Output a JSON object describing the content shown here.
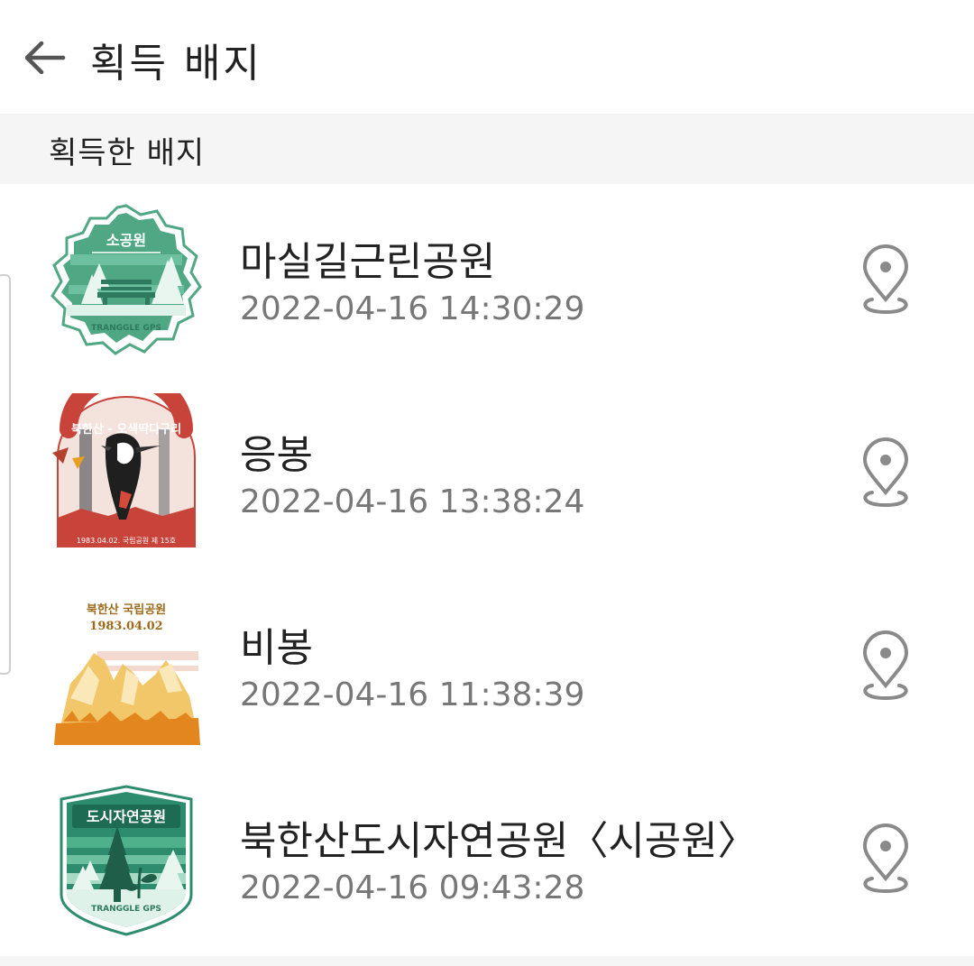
{
  "header": {
    "title": "획득 배지"
  },
  "section": {
    "title": "획득한 배지"
  },
  "badges": [
    {
      "name": "마실길근린공원",
      "time": "2022-04-16 14:30:29",
      "badge_text": "소공원",
      "badge_sub": "TRANGGLE GPS"
    },
    {
      "name": "응봉",
      "time": "2022-04-16 13:38:24",
      "badge_text": "북한산 - 오색딱다구리",
      "badge_sub": "1983.04.02. 국립공원 제 15호"
    },
    {
      "name": "비봉",
      "time": "2022-04-16 11:38:39",
      "badge_text": "북한산 국립공원",
      "badge_sub": "1983.04.02"
    },
    {
      "name": "북한산도시자연공원〈시공원〉",
      "time": "2022-04-16 09:43:28",
      "badge_text": "도시자연공원",
      "badge_sub": "TRANGGLE GPS"
    }
  ],
  "colors": {
    "accent_green": "#4fa883",
    "dark_green": "#2e8c6e",
    "text": "#222222",
    "subtext": "#777777",
    "icon": "#8a8a8a"
  }
}
